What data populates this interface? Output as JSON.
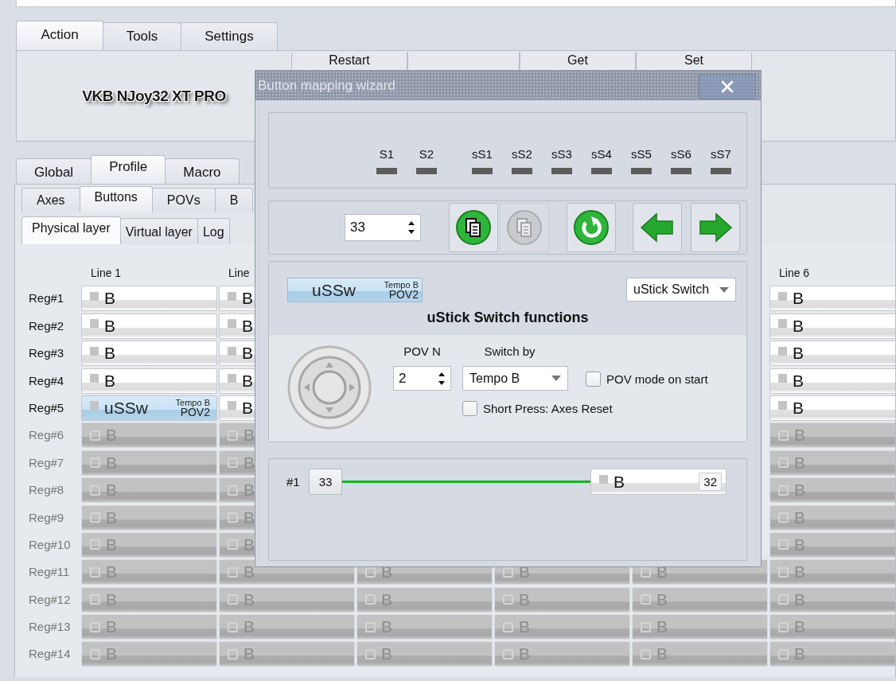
{
  "ribbon": {
    "tabs": [
      {
        "label": "Action",
        "selected": true
      },
      {
        "label": "Tools",
        "selected": false
      },
      {
        "label": "Settings",
        "selected": false
      }
    ],
    "device_name": "VKB NJoy32 XT PRO",
    "buttons": [
      {
        "kind": "button",
        "label": "Restart"
      },
      {
        "kind": "spacer"
      },
      {
        "kind": "button",
        "label": "Get"
      },
      {
        "kind": "button",
        "label": "Set"
      }
    ]
  },
  "profile_tabs": [
    {
      "label": "Global",
      "selected": false
    },
    {
      "label": "Profile",
      "selected": true
    },
    {
      "label": "Macro",
      "selected": false
    }
  ],
  "section_tabs": [
    {
      "label": "Axes",
      "selected": false
    },
    {
      "label": "Buttons",
      "selected": true
    },
    {
      "label": "POVs",
      "selected": false
    },
    {
      "label": "B",
      "selected": false
    }
  ],
  "layer_tabs": [
    {
      "label": "Physical layer",
      "selected": true
    },
    {
      "label": "Virtual layer",
      "selected": false
    },
    {
      "label": "Log",
      "selected": false
    }
  ],
  "grid": {
    "columns": [
      "Line 1",
      "Line",
      null,
      null,
      null,
      "Line 6"
    ],
    "rows": [
      {
        "label": "Reg#1",
        "enabled": true,
        "cells": [
          {
            "kind": "button",
            "label": "B"
          },
          {
            "kind": "button",
            "label": "B"
          },
          null,
          null,
          null,
          {
            "kind": "button",
            "label": "B"
          }
        ]
      },
      {
        "label": "Reg#2",
        "enabled": true,
        "cells": [
          {
            "kind": "button",
            "label": "B"
          },
          {
            "kind": "button",
            "label": "B"
          },
          null,
          null,
          null,
          {
            "kind": "button",
            "label": "B"
          }
        ]
      },
      {
        "label": "Reg#3",
        "enabled": true,
        "cells": [
          {
            "kind": "button",
            "label": "B"
          },
          {
            "kind": "button",
            "label": "B"
          },
          null,
          null,
          null,
          {
            "kind": "button",
            "label": "B"
          }
        ]
      },
      {
        "label": "Reg#4",
        "enabled": true,
        "cells": [
          {
            "kind": "button",
            "label": "B"
          },
          {
            "kind": "button",
            "label": "B"
          },
          null,
          null,
          null,
          {
            "kind": "button",
            "label": "B"
          }
        ]
      },
      {
        "label": "Reg#5",
        "enabled": true,
        "cells": [
          {
            "kind": "ussw",
            "label": "uSSw",
            "sub_top": "Tempo B",
            "sub_bottom": "POV2"
          },
          {
            "kind": "button",
            "label": "B"
          },
          null,
          null,
          null,
          {
            "kind": "button",
            "label": "B"
          }
        ]
      },
      {
        "label": "Reg#6",
        "enabled": false,
        "cells": [
          {
            "kind": "button",
            "label": "B"
          },
          {
            "kind": "button",
            "label": "B"
          },
          null,
          null,
          null,
          {
            "kind": "button",
            "label": "B"
          }
        ]
      },
      {
        "label": "Reg#7",
        "enabled": false,
        "cells": [
          {
            "kind": "button",
            "label": "B"
          },
          {
            "kind": "button",
            "label": "B"
          },
          null,
          null,
          null,
          {
            "kind": "button",
            "label": "B"
          }
        ]
      },
      {
        "label": "Reg#8",
        "enabled": false,
        "cells": [
          {
            "kind": "button",
            "label": "B"
          },
          {
            "kind": "button",
            "label": "B"
          },
          null,
          null,
          null,
          {
            "kind": "button",
            "label": "B"
          }
        ]
      },
      {
        "label": "Reg#9",
        "enabled": false,
        "cells": [
          {
            "kind": "button",
            "label": "B"
          },
          {
            "kind": "button",
            "label": "B"
          },
          null,
          null,
          null,
          {
            "kind": "button",
            "label": "B"
          }
        ]
      },
      {
        "label": "Reg#10",
        "enabled": false,
        "cells": [
          {
            "kind": "button",
            "label": "B"
          },
          {
            "kind": "button",
            "label": "B"
          },
          null,
          null,
          null,
          {
            "kind": "button",
            "label": "B"
          }
        ]
      },
      {
        "label": "Reg#11",
        "enabled": false,
        "cells": [
          {
            "kind": "button",
            "label": "B"
          },
          {
            "kind": "button",
            "label": "B"
          },
          {
            "kind": "button",
            "label": "B"
          },
          {
            "kind": "button",
            "label": "B"
          },
          {
            "kind": "button",
            "label": "B"
          },
          {
            "kind": "button",
            "label": "B"
          }
        ]
      },
      {
        "label": "Reg#12",
        "enabled": false,
        "cells": [
          {
            "kind": "button",
            "label": "B"
          },
          {
            "kind": "button",
            "label": "B"
          },
          {
            "kind": "button",
            "label": "B"
          },
          {
            "kind": "button",
            "label": "B"
          },
          {
            "kind": "button",
            "label": "B"
          },
          {
            "kind": "button",
            "label": "B"
          }
        ]
      },
      {
        "label": "Reg#13",
        "enabled": false,
        "cells": [
          {
            "kind": "button",
            "label": "B"
          },
          {
            "kind": "button",
            "label": "B"
          },
          {
            "kind": "button",
            "label": "B"
          },
          {
            "kind": "button",
            "label": "B"
          },
          {
            "kind": "button",
            "label": "B"
          },
          {
            "kind": "button",
            "label": "B"
          }
        ]
      },
      {
        "label": "Reg#14",
        "enabled": false,
        "cells": [
          {
            "kind": "button",
            "label": "B"
          },
          {
            "kind": "button",
            "label": "B"
          },
          {
            "kind": "button",
            "label": "B"
          },
          {
            "kind": "button",
            "label": "B"
          },
          {
            "kind": "button",
            "label": "B"
          },
          {
            "kind": "button",
            "label": "B"
          }
        ]
      }
    ]
  },
  "wizard": {
    "title": "Button mapping wizard",
    "shift_indicators": [
      "S1",
      "S2"
    ],
    "subshift_indicators": [
      "sS1",
      "sS2",
      "sS3",
      "sS4",
      "sS5",
      "sS6",
      "sS7"
    ],
    "index": "33",
    "toolbar": [
      {
        "kind": "copy",
        "disabled": false
      },
      {
        "kind": "paste",
        "disabled": true
      },
      {
        "kind": "reset",
        "disabled": false
      },
      {
        "kind": "prev",
        "disabled": false
      },
      {
        "kind": "next",
        "disabled": false
      }
    ],
    "function": {
      "button": {
        "label": "uSSw",
        "sub_top": "Tempo B",
        "sub_bottom": "POV2"
      },
      "type": "uStick Switch",
      "title": "uStick Switch functions",
      "pov_n_label": "POV N",
      "pov_n": "2",
      "switch_by_label": "Switch by",
      "switch_by": "Tempo B",
      "options": [
        {
          "label": "POV mode on start",
          "checked": false
        },
        {
          "label": "Short Press: Axes Reset",
          "checked": false
        }
      ]
    },
    "links": [
      {
        "label": "#1",
        "source": "33",
        "target": "B",
        "target_number": "32"
      }
    ]
  }
}
